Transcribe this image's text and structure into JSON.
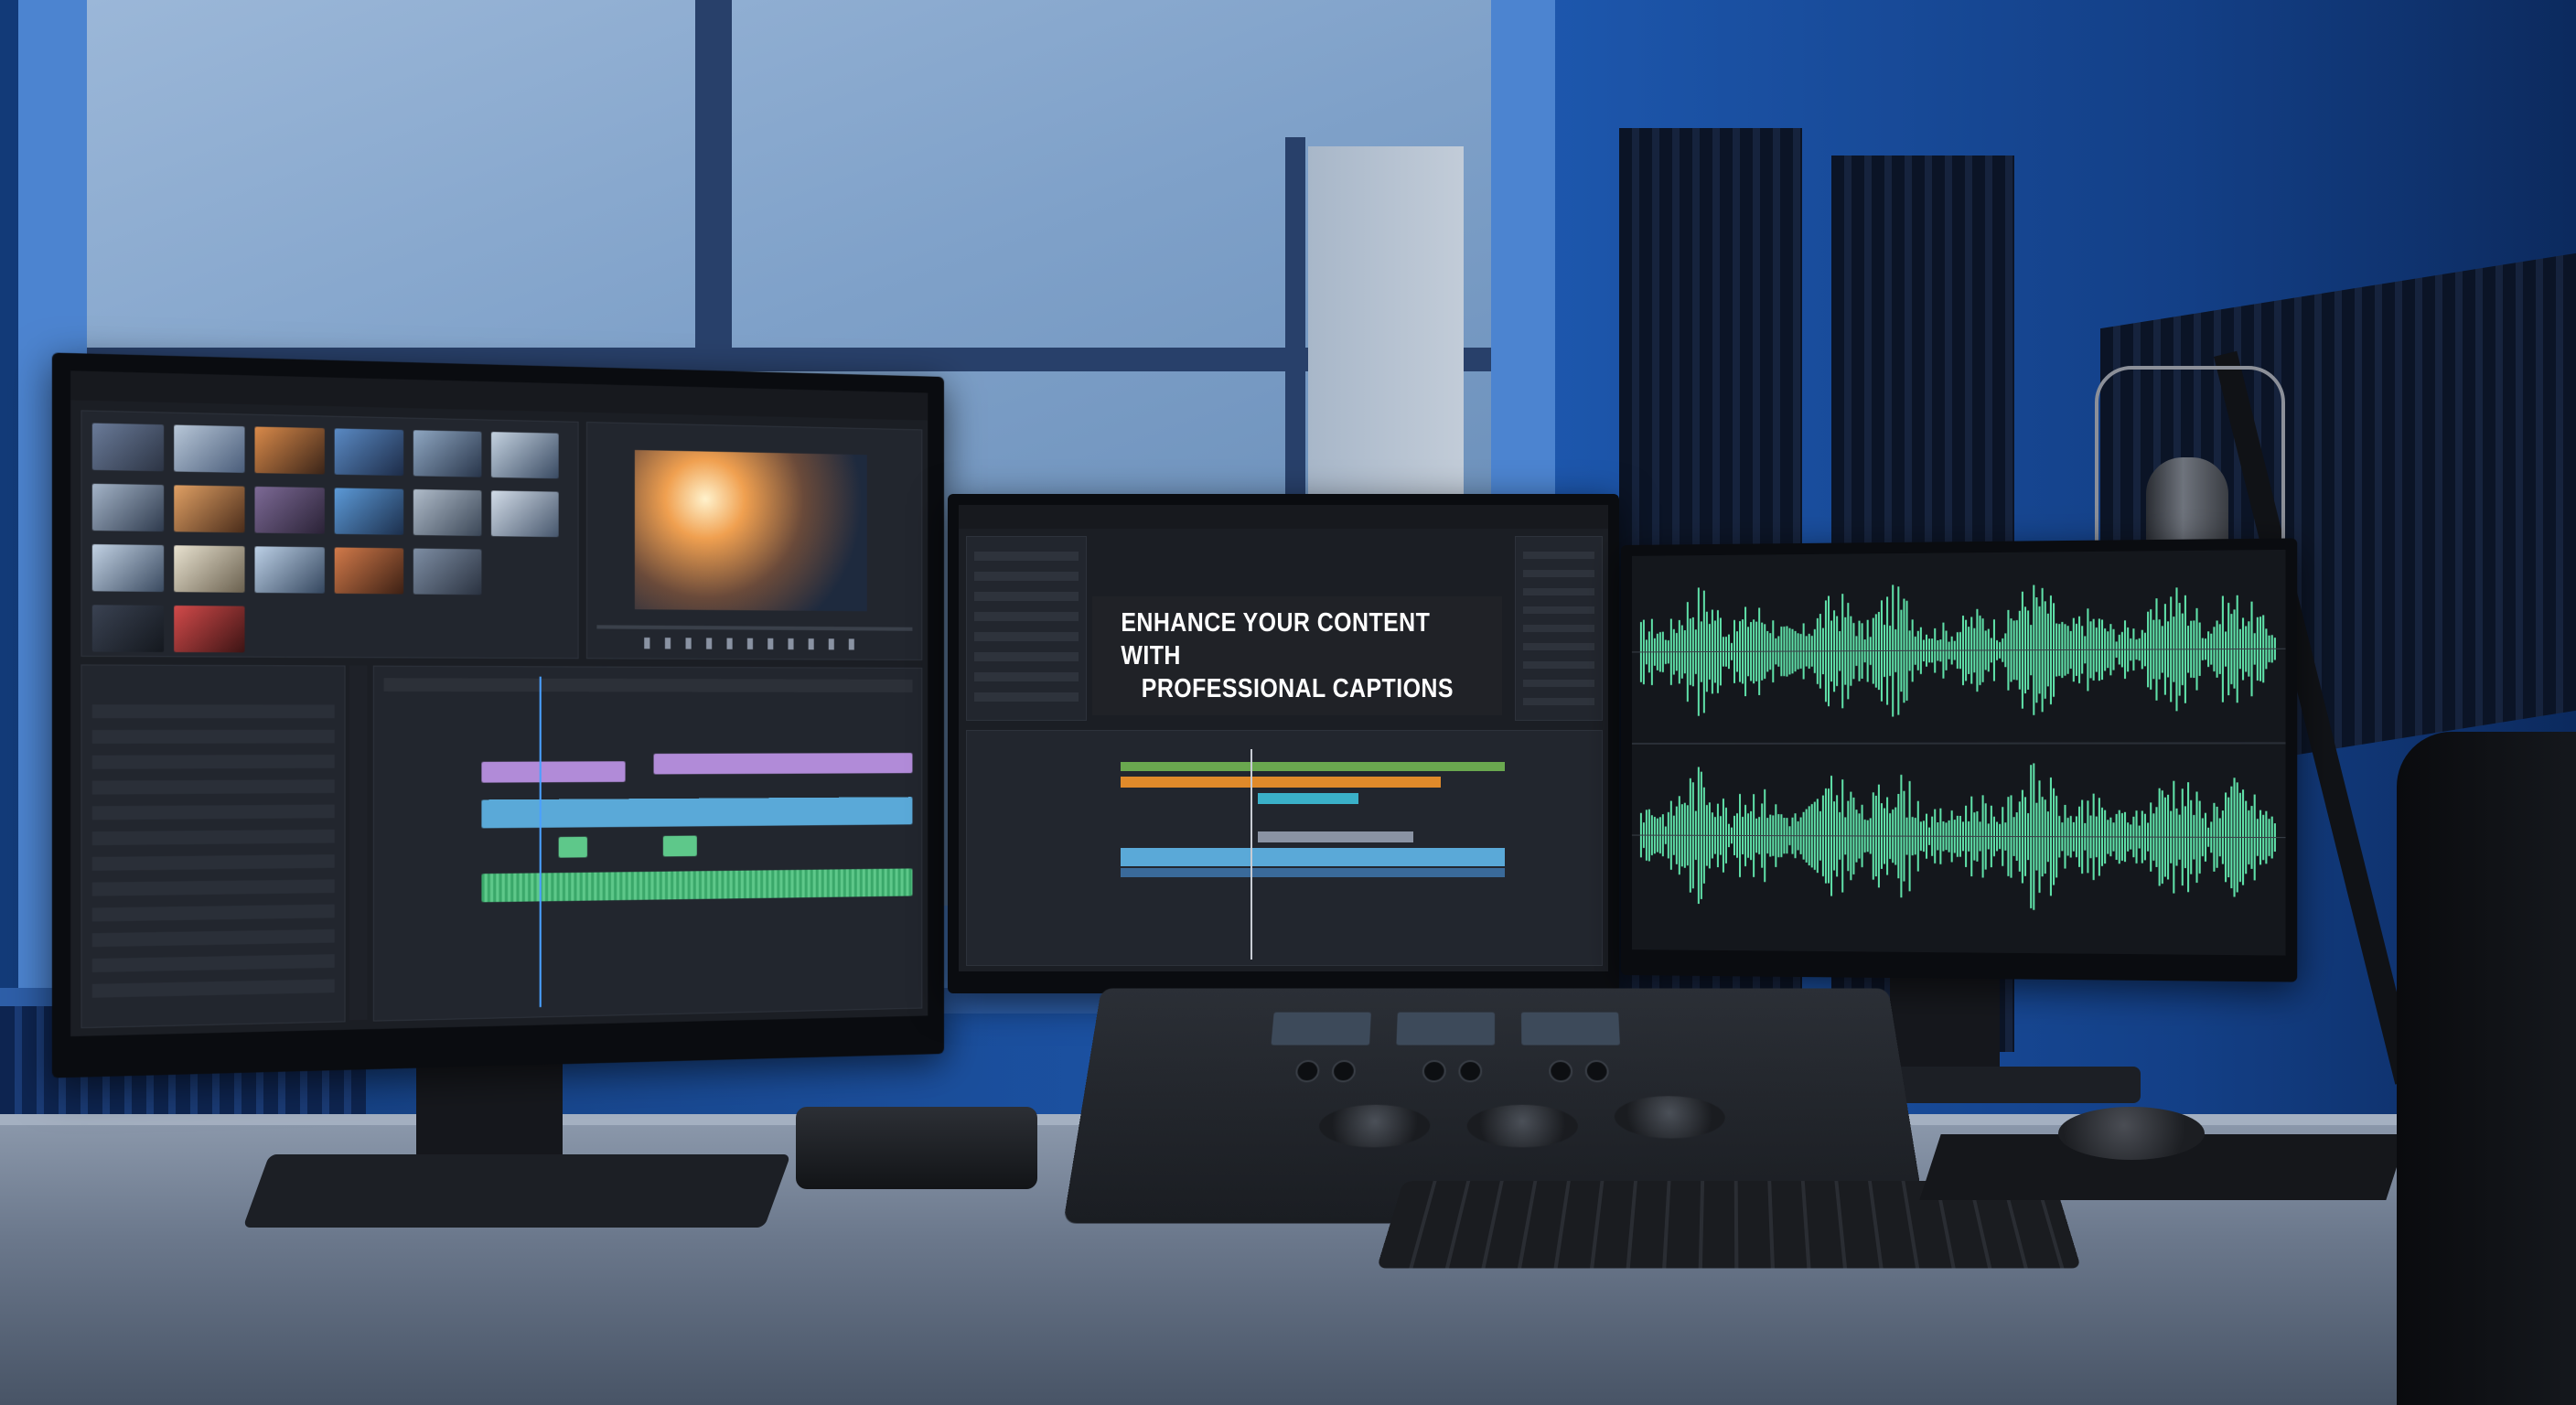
{
  "scene": {
    "description_visible_text_only": true
  },
  "editor_monitor": {
    "ui_name": "video-editor"
  },
  "caption_monitor": {
    "caption_line_1": "ENHANCE YOUR CONTENT WITH",
    "caption_line_2": "PROFESSIONAL CAPTIONS"
  },
  "audio_monitor": {
    "waveform_color": "#5fe0a8"
  },
  "colors": {
    "wall": "#1a4d9a",
    "window_frame": "#4c84d0",
    "timeline_purple": "#b18bd8",
    "timeline_blue": "#5aa9d8",
    "timeline_green": "#5ec88a",
    "timeline_orange": "#e08a2a"
  },
  "icons": [
    "microphone-icon",
    "trackball-icon",
    "keyboard-icon",
    "mouse-icon"
  ]
}
